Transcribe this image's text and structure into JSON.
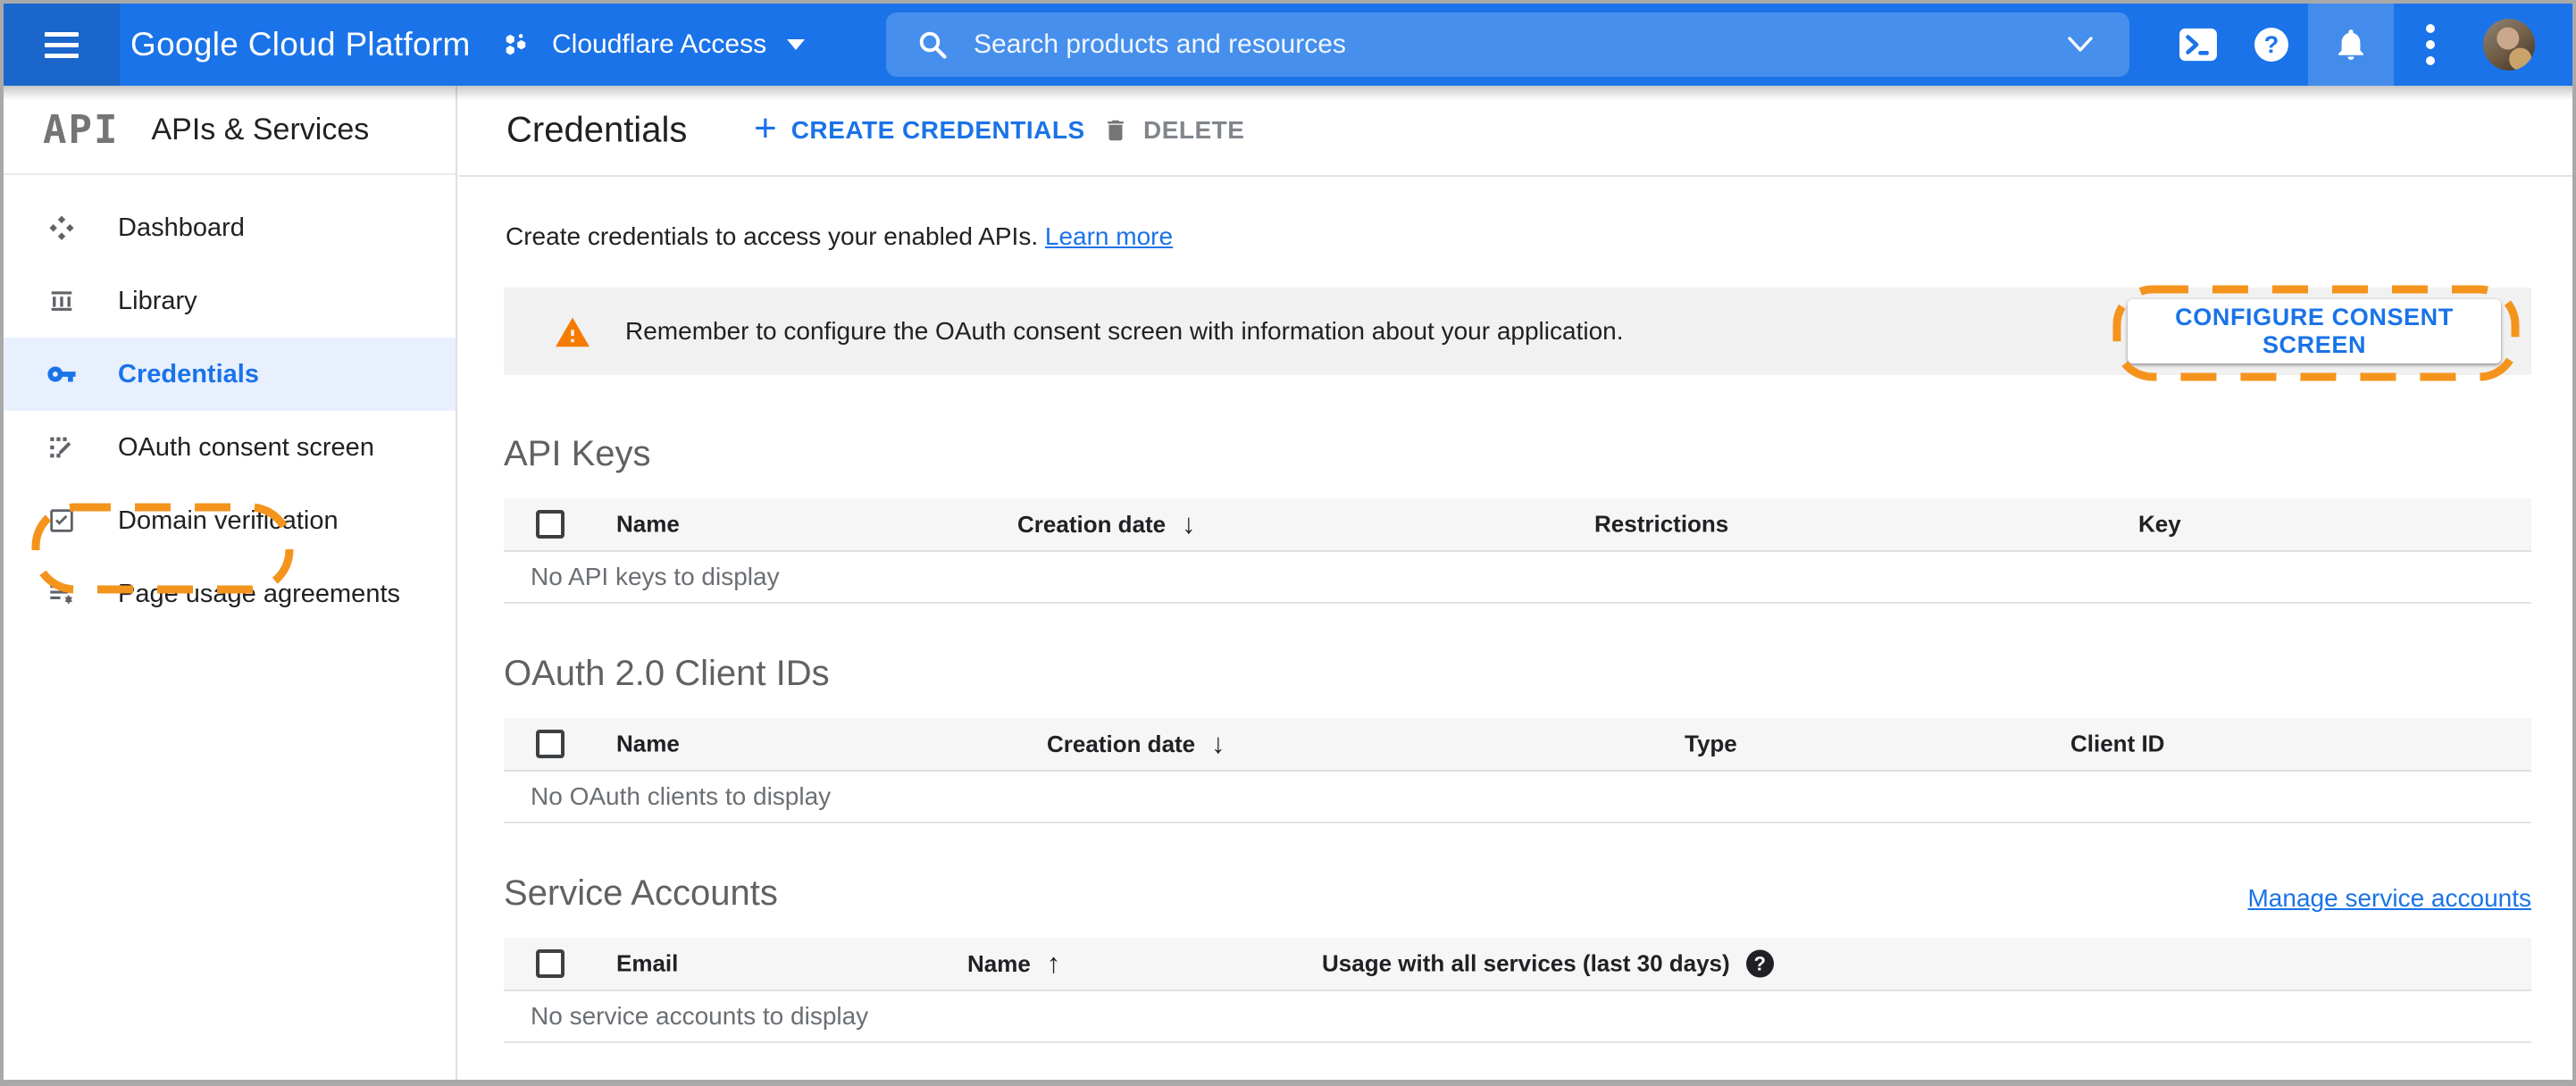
{
  "colors": {
    "header_blue": "#1a73e8",
    "header_menu_blue": "#1a66cc",
    "accent_blue": "#1a73e8",
    "selected_row_bg": "#e8f0fe",
    "annotation_orange": "#f5941d",
    "warning_orange": "#f57c00",
    "banner_bg": "#f1f1f1",
    "table_header_bg": "#f6f6f6"
  },
  "icons": {
    "plus": "+",
    "help_glyph": "?",
    "sort_desc": "↓",
    "sort_asc": "↑"
  },
  "header": {
    "product_name": "Google Cloud Platform",
    "project": {
      "label": "Cloudflare Access"
    },
    "search": {
      "placeholder": "Search products and resources"
    }
  },
  "sidebar": {
    "logo_text": "API",
    "title": "APIs & Services",
    "items": [
      {
        "label": "Dashboard",
        "selected": false
      },
      {
        "label": "Library",
        "selected": false
      },
      {
        "label": "Credentials",
        "selected": true,
        "annotated": true
      },
      {
        "label": "OAuth consent screen",
        "selected": false
      },
      {
        "label": "Domain verification",
        "selected": false
      },
      {
        "label": "Page usage agreements",
        "selected": false
      }
    ]
  },
  "page": {
    "appbar": {
      "title": "Credentials",
      "create_label": "CREATE CREDENTIALS",
      "delete_label": "DELETE"
    },
    "intro": {
      "text": "Create credentials to access your enabled APIs.",
      "link_label": "Learn more"
    },
    "banner": {
      "text": "Remember to configure the OAuth consent screen with information about your application.",
      "action_label": "CONFIGURE CONSENT SCREEN",
      "annotated": true
    },
    "sections": {
      "api_keys": {
        "title": "API Keys",
        "columns": [
          "Name",
          "Creation date",
          "Restrictions",
          "Key"
        ],
        "sort": {
          "column": "Creation date",
          "direction": "desc"
        },
        "empty_text": "No API keys to display"
      },
      "oauth_clients": {
        "title": "OAuth 2.0 Client IDs",
        "columns": [
          "Name",
          "Creation date",
          "Type",
          "Client ID"
        ],
        "sort": {
          "column": "Creation date",
          "direction": "desc"
        },
        "empty_text": "No OAuth clients to display"
      },
      "service_accounts": {
        "title": "Service Accounts",
        "manage_link_label": "Manage service accounts",
        "columns": [
          "Email",
          "Name",
          "Usage with all services (last 30 days)"
        ],
        "sort": {
          "column": "Name",
          "direction": "asc"
        },
        "empty_text": "No service accounts to display"
      }
    }
  }
}
